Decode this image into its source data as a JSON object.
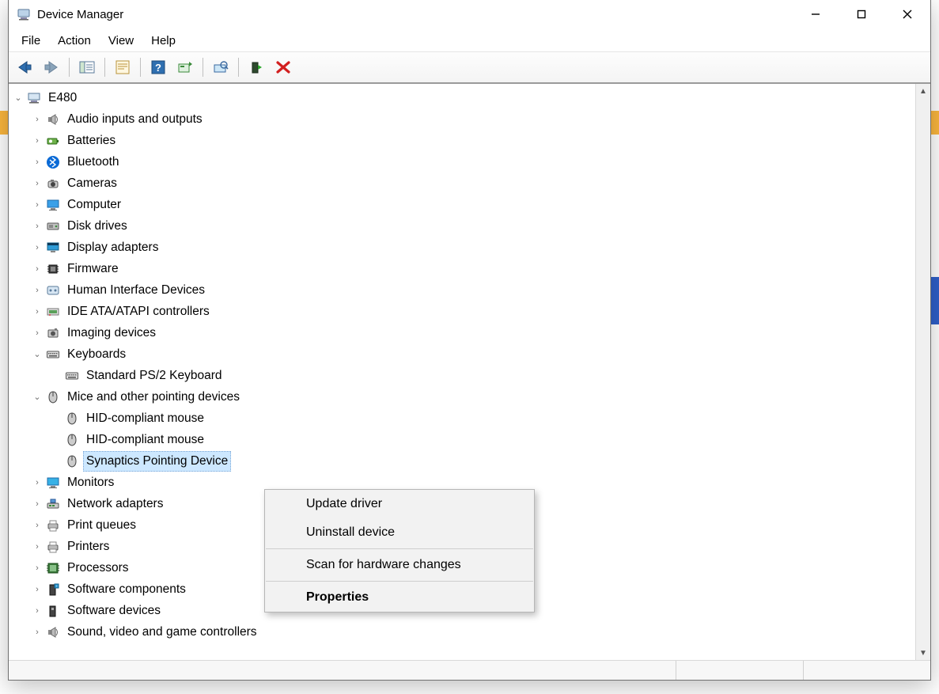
{
  "window": {
    "title": "Device Manager"
  },
  "menubar": {
    "file": "File",
    "action": "Action",
    "view": "View",
    "help": "Help"
  },
  "toolbar": {
    "back": "Back",
    "forward": "Forward",
    "show_hide_console": "Show/Hide Console Tree",
    "properties": "Properties",
    "help": "Help",
    "update_driver": "Update Device Driver",
    "scan": "Scan for hardware changes",
    "enable": "Enable device",
    "disable_x": "Disable device"
  },
  "tree": {
    "root": {
      "label": "E480",
      "icon": "computer-root-icon",
      "expanded": true
    },
    "nodes": [
      {
        "label": "Audio inputs and outputs",
        "icon": "speaker-icon",
        "expanded": false
      },
      {
        "label": "Batteries",
        "icon": "battery-icon",
        "expanded": false
      },
      {
        "label": "Bluetooth",
        "icon": "bluetooth-icon",
        "expanded": false
      },
      {
        "label": "Cameras",
        "icon": "camera-icon",
        "expanded": false
      },
      {
        "label": "Computer",
        "icon": "monitor-icon",
        "expanded": false
      },
      {
        "label": "Disk drives",
        "icon": "disk-icon",
        "expanded": false
      },
      {
        "label": "Display adapters",
        "icon": "display-icon",
        "expanded": false
      },
      {
        "label": "Firmware",
        "icon": "chip-icon",
        "expanded": false
      },
      {
        "label": "Human Interface Devices",
        "icon": "hid-icon",
        "expanded": false
      },
      {
        "label": "IDE ATA/ATAPI controllers",
        "icon": "ide-icon",
        "expanded": false
      },
      {
        "label": "Imaging devices",
        "icon": "imaging-icon",
        "expanded": false
      },
      {
        "label": "Keyboards",
        "icon": "keyboard-icon",
        "expanded": true,
        "children": [
          {
            "label": "Standard PS/2 Keyboard",
            "icon": "keyboard-icon"
          }
        ]
      },
      {
        "label": "Mice and other pointing devices",
        "icon": "mouse-icon",
        "expanded": true,
        "children": [
          {
            "label": "HID-compliant mouse",
            "icon": "mouse-icon"
          },
          {
            "label": "HID-compliant mouse",
            "icon": "mouse-icon"
          },
          {
            "label": "Synaptics Pointing Device",
            "icon": "mouse-icon",
            "selected": true
          }
        ]
      },
      {
        "label": "Monitors",
        "icon": "monitor2-icon",
        "expanded": false
      },
      {
        "label": "Network adapters",
        "icon": "network-icon",
        "expanded": false
      },
      {
        "label": "Print queues",
        "icon": "printer-icon",
        "expanded": false
      },
      {
        "label": "Printers",
        "icon": "printer-icon",
        "expanded": false
      },
      {
        "label": "Processors",
        "icon": "cpu-icon",
        "expanded": false
      },
      {
        "label": "Software components",
        "icon": "softcomp-icon",
        "expanded": false
      },
      {
        "label": "Software devices",
        "icon": "softdev-icon",
        "expanded": false
      },
      {
        "label": "Sound, video and game controllers",
        "icon": "speaker-icon",
        "expanded": false
      }
    ]
  },
  "context_menu": {
    "update_driver": "Update driver",
    "uninstall_device": "Uninstall device",
    "scan": "Scan for hardware changes",
    "properties": "Properties"
  }
}
